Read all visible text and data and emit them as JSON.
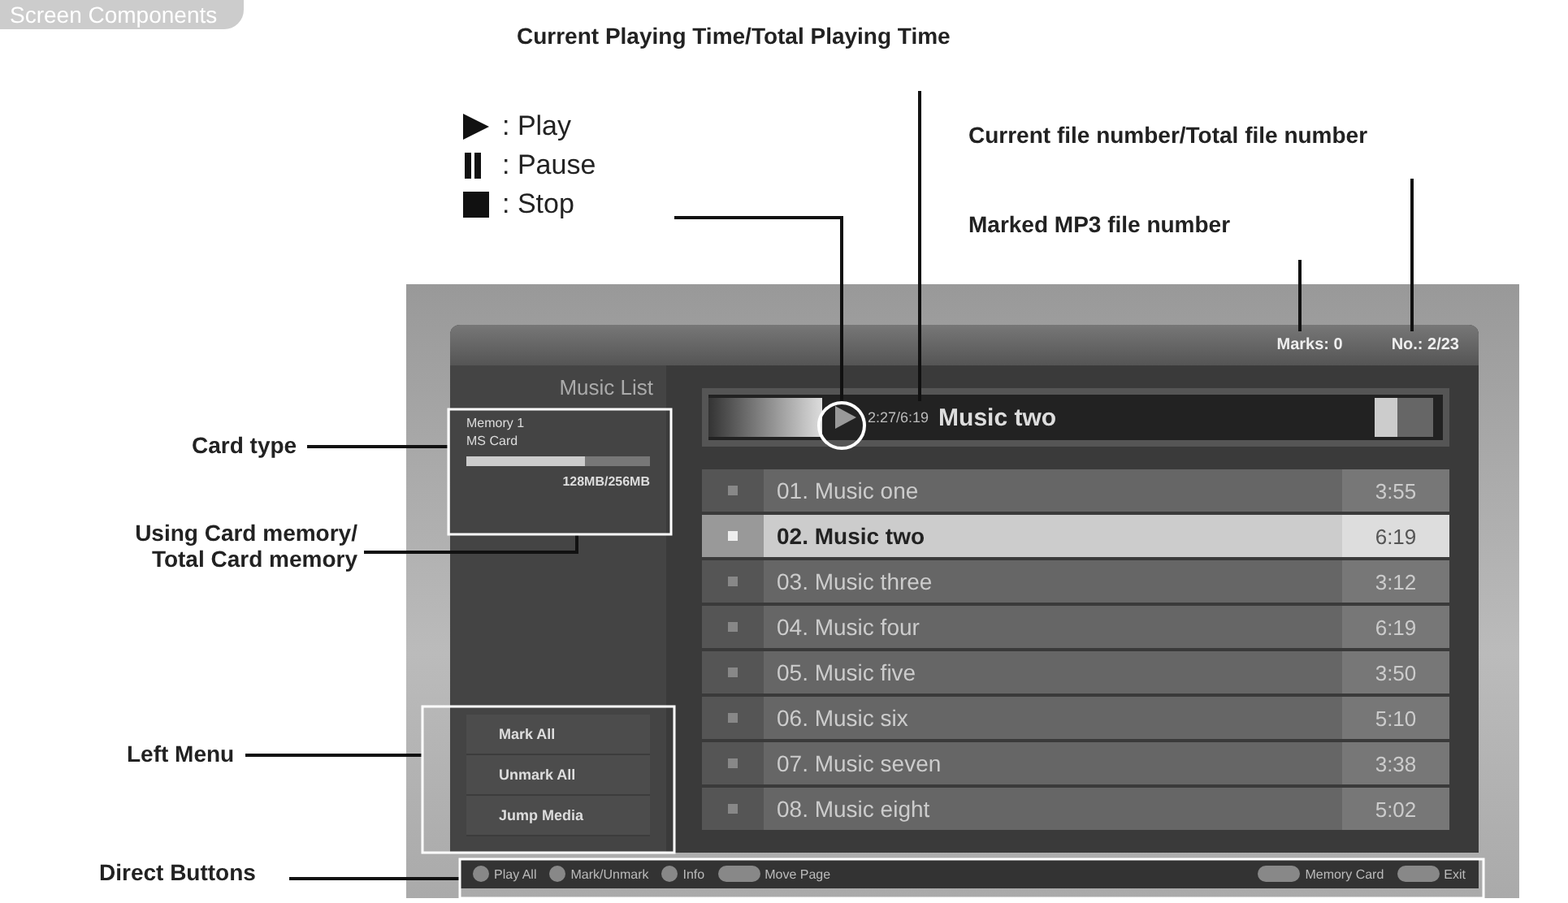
{
  "section_tab": {
    "label": "Screen Components"
  },
  "legend": [
    {
      "kind": "play",
      "label": ": Play"
    },
    {
      "kind": "pause",
      "label": ": Pause"
    },
    {
      "kind": "stop",
      "label": ": Stop"
    }
  ],
  "callouts": {
    "playing_time": "Current Playing Time/Total Playing Time",
    "file_number": "Current file number/Total file number",
    "marked": "Marked MP3 file number",
    "card_type": "Card type",
    "card_memory": "Using Card memory/\nTotal Card memory",
    "left_menu": "Left Menu",
    "direct_buttons": "Direct Buttons"
  },
  "screen": {
    "header": {
      "marks": "Marks: 0",
      "number": "No.: 2/23"
    },
    "title": "Music List",
    "card": {
      "slot": "Memory 1",
      "type": "MS Card",
      "level": 0.65,
      "usage": "128MB/256MB"
    },
    "player": {
      "time": "2:27/6:19",
      "track": "Music two"
    },
    "tracks": [
      {
        "title": "01. Music one",
        "duration": "3:55",
        "selected": false
      },
      {
        "title": "02. Music two",
        "duration": "6:19",
        "selected": true
      },
      {
        "title": "03. Music three",
        "duration": "3:12",
        "selected": false
      },
      {
        "title": "04. Music four",
        "duration": "6:19",
        "selected": false
      },
      {
        "title": "05. Music five",
        "duration": "3:50",
        "selected": false
      },
      {
        "title": "06. Music six",
        "duration": "5:10",
        "selected": false
      },
      {
        "title": "07. Music seven",
        "duration": "3:38",
        "selected": false
      },
      {
        "title": "08. Music eight",
        "duration": "5:02",
        "selected": false
      }
    ],
    "left_menu": [
      "Mark All",
      "Unmark All",
      "Jump Media"
    ],
    "direct_buttons": [
      {
        "kind": "round",
        "label": "Play All"
      },
      {
        "kind": "round",
        "label": "Mark/Unmark"
      },
      {
        "kind": "round",
        "label": "Info"
      },
      {
        "kind": "key",
        "label": "Move Page"
      },
      {
        "kind": "key",
        "label": "Memory Card"
      },
      {
        "kind": "key",
        "label": "Exit"
      }
    ]
  }
}
